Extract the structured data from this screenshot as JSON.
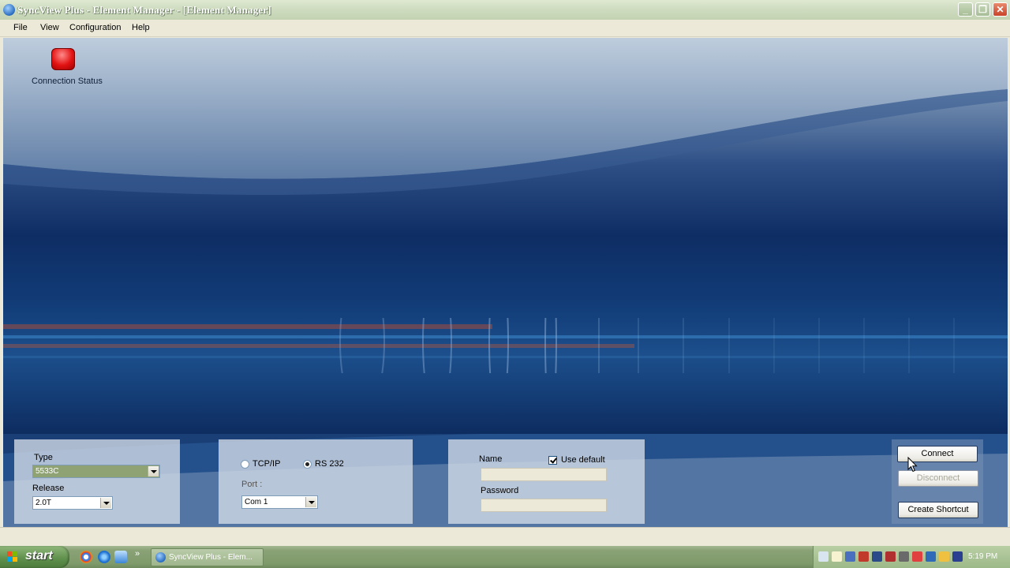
{
  "window": {
    "title": "SyncView Plus - Element Manager - [Element Manager]"
  },
  "menu": [
    "File",
    "View",
    "Configuration",
    "Help"
  ],
  "connection_status": {
    "label": "Connection Status",
    "state_color": "#e21212"
  },
  "device": {
    "type_label": "Type",
    "type_value": "5533C",
    "release_label": "Release",
    "release_value": "2.0T"
  },
  "comm": {
    "tcpip_label": "TCP/IP",
    "rs232_label": "RS 232",
    "selected": "RS 232",
    "port_label": "Port :",
    "port_value": "Com 1"
  },
  "login": {
    "name_label": "Name",
    "use_default_label": "Use default",
    "use_default_checked": true,
    "name_value": "",
    "password_label": "Password",
    "password_value": ""
  },
  "actions": {
    "connect": "Connect",
    "disconnect": "Disconnect",
    "create_shortcut": "Create Shortcut"
  },
  "taskbar": {
    "start": "start",
    "app_button": "SyncView Plus - Elem...",
    "clock": "5:19 PM"
  },
  "icons": [
    "app-icon",
    "minimize-icon",
    "maximize-icon",
    "close-icon",
    "chrome-icon",
    "ie-icon",
    "ie-alt-icon",
    "windows-logo-icon"
  ]
}
